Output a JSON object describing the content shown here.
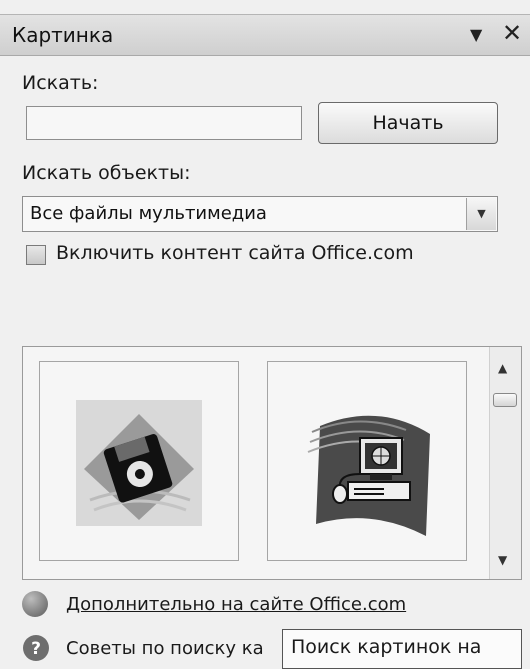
{
  "pane": {
    "title": "Картинка",
    "menu_glyph": "▼",
    "close_glyph": "✕"
  },
  "search": {
    "label": "Искать:",
    "value": "",
    "go_label": "Начать"
  },
  "media_type": {
    "label": "Искать объекты:",
    "selected": "Все файлы мультимедиа"
  },
  "office_content": {
    "label": "Включить контент сайта Office.com",
    "checked": false
  },
  "results": {
    "items": [
      {
        "icon": "floppy-disk-icon"
      },
      {
        "icon": "networked-computer-icon"
      }
    ]
  },
  "footer": {
    "more_link": "Дополнительно на сайте Office.com",
    "tips_link": "Советы по поиску ка",
    "tooltip": "Поиск картинок на"
  },
  "colors": {
    "titlebar": "#d6d6d6",
    "background": "#f0f0f0"
  }
}
